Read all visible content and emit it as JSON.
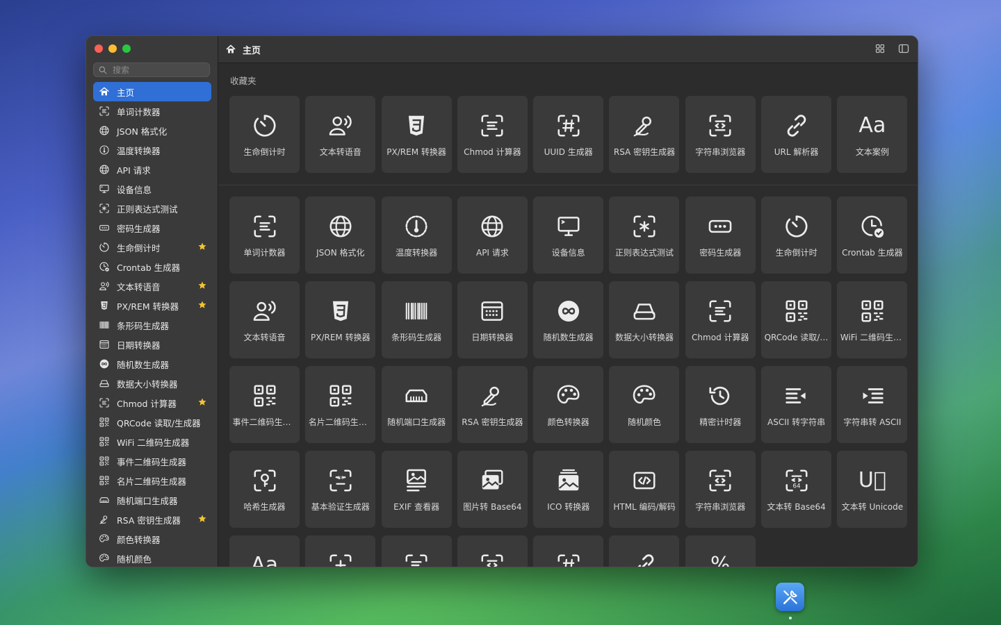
{
  "window": {
    "title": "主页"
  },
  "search": {
    "placeholder": "搜索"
  },
  "sidebar": {
    "items": [
      {
        "label": "主页",
        "icon": "home-icon",
        "active": true,
        "star": false
      },
      {
        "label": "单词计数器",
        "icon": "text-scan-icon",
        "star": false
      },
      {
        "label": "JSON 格式化",
        "icon": "globe-icon",
        "star": false
      },
      {
        "label": "温度转换器",
        "icon": "thermometer-gear-icon",
        "star": false
      },
      {
        "label": "API 请求",
        "icon": "globe-icon",
        "star": false
      },
      {
        "label": "设备信息",
        "icon": "monitor-icon",
        "star": false
      },
      {
        "label": "正则表达式测试",
        "icon": "regex-scan-icon",
        "star": false
      },
      {
        "label": "密码生成器",
        "icon": "password-dots-icon",
        "star": false
      },
      {
        "label": "生命倒计时",
        "icon": "timer-icon",
        "star": true
      },
      {
        "label": "Crontab 生成器",
        "icon": "clock-check-icon",
        "star": false
      },
      {
        "label": "文本转语音",
        "icon": "person-wave-icon",
        "star": true
      },
      {
        "label": "PX/REM 转换器",
        "icon": "css3-icon",
        "star": true
      },
      {
        "label": "条形码生成器",
        "icon": "barcode-icon",
        "star": false
      },
      {
        "label": "日期转换器",
        "icon": "calendar-icon",
        "star": false
      },
      {
        "label": "随机数生成器",
        "icon": "infinity-icon",
        "star": false
      },
      {
        "label": "数据大小转换器",
        "icon": "drive-icon",
        "star": false
      },
      {
        "label": "Chmod 计算器",
        "icon": "text-scan-icon",
        "star": true
      },
      {
        "label": "QRCode 读取/生成器",
        "icon": "qrcode-icon",
        "star": false
      },
      {
        "label": "WiFi 二维码生成器",
        "icon": "qrcode-icon",
        "star": false
      },
      {
        "label": "事件二维码生成器",
        "icon": "qrcode-icon",
        "star": false
      },
      {
        "label": "名片二维码生成器",
        "icon": "qrcode-icon",
        "star": false
      },
      {
        "label": "随机端口生成器",
        "icon": "port-icon",
        "star": false
      },
      {
        "label": "RSA 密钥生成器",
        "icon": "key-signature-icon",
        "star": true
      },
      {
        "label": "颜色转换器",
        "icon": "palette-icon",
        "star": false
      },
      {
        "label": "随机颜色",
        "icon": "palette-icon",
        "star": false
      }
    ]
  },
  "favorites": {
    "label": "收藏夹",
    "tiles": [
      {
        "label": "生命倒计时",
        "icon": "timer-icon"
      },
      {
        "label": "文本转语音",
        "icon": "person-wave-icon"
      },
      {
        "label": "PX/REM 转换器",
        "icon": "css3-icon"
      },
      {
        "label": "Chmod 计算器",
        "icon": "text-scan-icon"
      },
      {
        "label": "UUID 生成器",
        "icon": "hash-scan-icon"
      },
      {
        "label": "RSA 密钥生成器",
        "icon": "key-signature-icon"
      },
      {
        "label": "字符串浏览器",
        "icon": "code-scan-icon"
      },
      {
        "label": "URL 解析器",
        "icon": "link-icon"
      },
      {
        "label": "文本案例",
        "icon": "text-case-icon",
        "text": "Aa"
      }
    ]
  },
  "all_tools": {
    "tiles": [
      {
        "label": "单词计数器",
        "icon": "text-scan-icon"
      },
      {
        "label": "JSON 格式化",
        "icon": "globe-icon"
      },
      {
        "label": "温度转换器",
        "icon": "thermometer-gear-icon"
      },
      {
        "label": "API 请求",
        "icon": "globe-icon"
      },
      {
        "label": "设备信息",
        "icon": "monitor-icon"
      },
      {
        "label": "正则表达式测试",
        "icon": "regex-scan-icon"
      },
      {
        "label": "密码生成器",
        "icon": "password-dots-icon"
      },
      {
        "label": "生命倒计时",
        "icon": "timer-icon"
      },
      {
        "label": "Crontab 生成器",
        "icon": "clock-check-icon"
      },
      {
        "label": "文本转语音",
        "icon": "person-wave-icon"
      },
      {
        "label": "PX/REM 转换器",
        "icon": "css3-icon"
      },
      {
        "label": "条形码生成器",
        "icon": "barcode-icon"
      },
      {
        "label": "日期转换器",
        "icon": "calendar-icon"
      },
      {
        "label": "随机数生成器",
        "icon": "infinity-icon"
      },
      {
        "label": "数据大小转换器",
        "icon": "drive-icon"
      },
      {
        "label": "Chmod 计算器",
        "icon": "text-scan-icon"
      },
      {
        "label": "QRCode 读取/生成器",
        "icon": "qrcode-icon"
      },
      {
        "label": "WiFi 二维码生成器",
        "icon": "qrcode-icon"
      },
      {
        "label": "事件二维码生成器",
        "icon": "qrcode-icon"
      },
      {
        "label": "名片二维码生成器",
        "icon": "qrcode-icon"
      },
      {
        "label": "随机端口生成器",
        "icon": "port-icon"
      },
      {
        "label": "RSA 密钥生成器",
        "icon": "key-signature-icon"
      },
      {
        "label": "颜色转换器",
        "icon": "palette-icon"
      },
      {
        "label": "随机颜色",
        "icon": "palette-icon"
      },
      {
        "label": "精密计时器",
        "icon": "history-icon"
      },
      {
        "label": "ASCII 转字符串",
        "icon": "list-arrow-left-icon"
      },
      {
        "label": "字符串转 ASCII",
        "icon": "list-arrow-right-icon"
      },
      {
        "label": "哈希生成器",
        "icon": "key-scan-icon"
      },
      {
        "label": "基本验证生成器",
        "icon": "asterisk-scan-icon"
      },
      {
        "label": "EXIF 查看器",
        "icon": "photo-text-icon"
      },
      {
        "label": "图片转 Base64",
        "icon": "photos-icon"
      },
      {
        "label": "ICO 转换器",
        "icon": "photo-stack-icon"
      },
      {
        "label": "HTML 编码/解码",
        "icon": "html-code-icon"
      },
      {
        "label": "字符串浏览器",
        "icon": "code-scan-icon"
      },
      {
        "label": "文本转 Base64",
        "icon": "base64-scan-icon"
      },
      {
        "label": "文本转 Unicode",
        "icon": "unicode-icon",
        "text": "U⃣"
      },
      {
        "label": "",
        "icon": "text-case-icon",
        "text": "Aa"
      },
      {
        "label": "",
        "icon": "plus-scan-icon"
      },
      {
        "label": "",
        "icon": "text-scan-icon"
      },
      {
        "label": "",
        "icon": "code-scan-icon"
      },
      {
        "label": "",
        "icon": "hash-scan-icon"
      },
      {
        "label": "",
        "icon": "link-icon"
      },
      {
        "label": "",
        "icon": "percent-icon",
        "text": "%"
      }
    ]
  },
  "colors": {
    "accent": "#2f6fd6",
    "star": "#f1c232"
  }
}
